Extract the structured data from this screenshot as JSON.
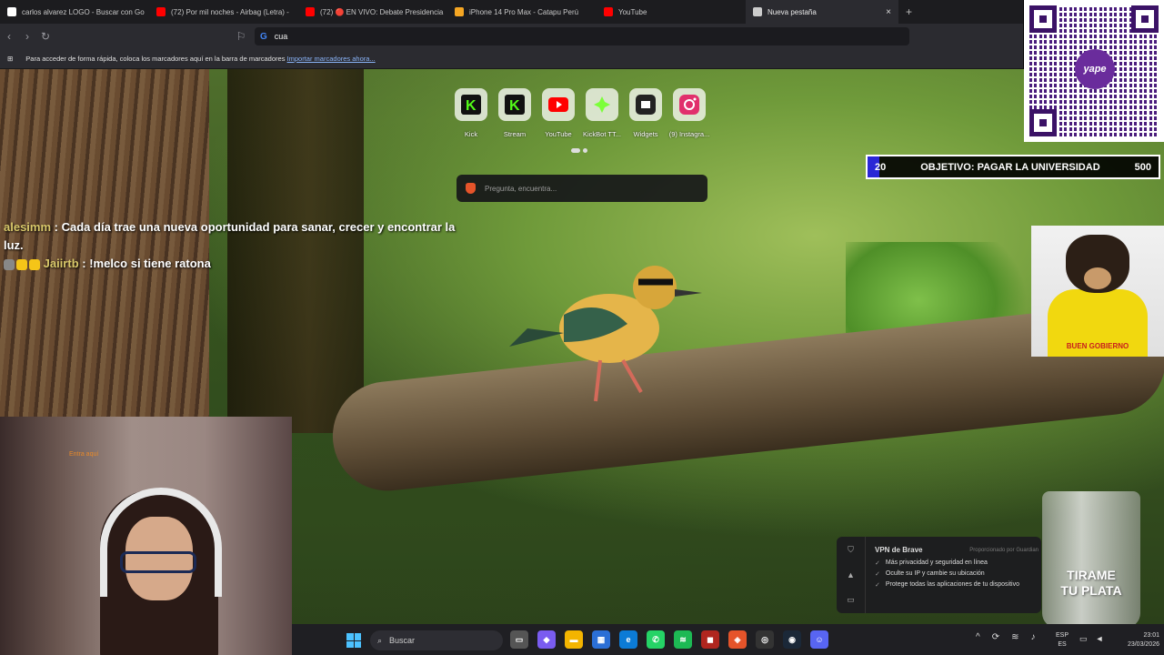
{
  "browser": {
    "tabs": [
      {
        "label": "carlos alvarez LOGO - Buscar con Go",
        "icon": "google-icon",
        "color": "#ffffff"
      },
      {
        "label": "(72) Por mil noches - Airbag (Letra) -",
        "icon": "youtube-icon",
        "color": "#ff0000"
      },
      {
        "label": "(72) 🔴 EN VIVO: Debate Presidencia",
        "icon": "youtube-icon",
        "color": "#ff0000"
      },
      {
        "label": "iPhone 14 Pro Max - Catapu Perú",
        "icon": "catapu-icon",
        "color": "#f5a623"
      },
      {
        "label": "YouTube",
        "icon": "youtube-icon",
        "color": "#ff0000"
      },
      {
        "label": "Nueva pestaña",
        "icon": "shield-icon",
        "color": "#cccccc",
        "active": true
      }
    ],
    "add_tab": "+",
    "close_tab": "×",
    "address": {
      "value": "cua"
    },
    "bookmarks_bar": {
      "message": "Para acceder de forma rápida, coloca los marcadores aquí en la barra de marcadores",
      "import_link": "Importar marcadores ahora..."
    }
  },
  "newtab": {
    "shortcuts": [
      {
        "label": "Kick",
        "icon": "kick-icon",
        "color": "#53fc18"
      },
      {
        "label": "Stream",
        "icon": "kick-icon",
        "color": "#53fc18"
      },
      {
        "label": "YouTube",
        "icon": "youtube-icon",
        "color": "#ff0000"
      },
      {
        "label": "KickBot TT...",
        "icon": "kickbot-icon",
        "color": "#7cff3a"
      },
      {
        "label": "Widgets",
        "icon": "widgets-icon",
        "color": "#222222"
      },
      {
        "label": "(9) Instagra...",
        "icon": "instagram-icon",
        "color": "#e1306c"
      }
    ],
    "search_placeholder": "Pregunta, encuentra..."
  },
  "chat": {
    "messages": [
      {
        "user": "alesimm",
        "text": ": Cada día trae una nueva oportunidad para sanar, crecer y encontrar la luz."
      },
      {
        "user": "Jaiirtb",
        "text": ": !melco si tiene ratona"
      }
    ]
  },
  "goal": {
    "current": "20",
    "label": "OBJETIVO: PAGAR LA UNIVERSIDAD",
    "target": "500",
    "progress_fraction": 0.04,
    "fill_color": "#2a27d6"
  },
  "qr": {
    "logo_text": "yape"
  },
  "dog": {
    "shirt_text": "BUEN GOBIERNO"
  },
  "webcam": {
    "tag": "Entra aquí"
  },
  "vpn": {
    "title": "VPN de Brave",
    "provider": "Proporcionado por Guardian",
    "items": [
      "Más privacidad y seguridad en línea",
      "Oculte su IP y cambie su ubicación",
      "Protege todas las aplicaciones de tu dispositivo"
    ]
  },
  "glass": {
    "line1": "TIRAME",
    "line2": "TU PLATA"
  },
  "taskbar": {
    "search_label": "Buscar",
    "lang_top": "ESP",
    "lang_bottom": "ES",
    "time": "23:01",
    "date": "23/03/2026"
  }
}
